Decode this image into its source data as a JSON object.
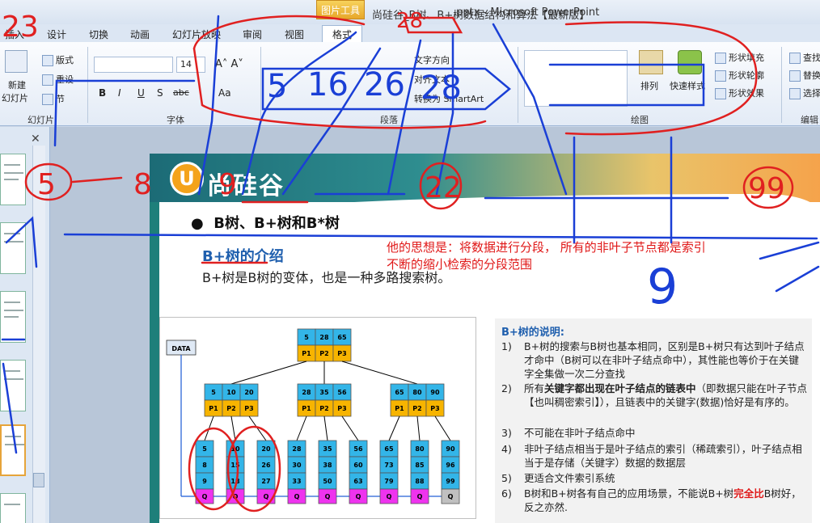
{
  "window": {
    "title_prefix": "尚硅谷_B树、B+树数据结构和算法【最新版】",
    "title": ".pptx - Microsoft PowerPoint",
    "picture_tools": "图片工具"
  },
  "tabs": [
    "插入",
    "设计",
    "切换",
    "动画",
    "幻灯片放映",
    "审阅",
    "视图",
    "格式"
  ],
  "ribbon": {
    "slides_group": {
      "new_slide": "新建",
      "new_slide_sub": "幻灯片",
      "layout": "版式",
      "reset": "重设",
      "section": "节",
      "label": "幻灯片"
    },
    "font_group": {
      "size": "14",
      "label": "字体"
    },
    "paragraph_group": {
      "label": "段落",
      "text_direction": "文字方向",
      "align_text": "对齐文本",
      "smartart": "转换为 SmartArt"
    },
    "drawing_group": {
      "arrange": "排列",
      "quick_styles": "快速样式",
      "shape_fill": "形状填充",
      "shape_outline": "形状轮廓",
      "shape_effects": "形状效果",
      "label": "绘图"
    },
    "editing_group": {
      "find": "查找",
      "replace": "替换",
      "select": "选择",
      "label": "编辑"
    }
  },
  "slide": {
    "logo_text": "尚硅谷",
    "bullet_title": "B树、B+树和B*树",
    "intro_head": "B+树的介绍",
    "intro_text": "B+树是B树的变体，也是一种多路搜索树。",
    "red_note_line1": "他的思想是：将数据进行分段， 所有的非叶子节点都是索引",
    "red_note_line2": "不断的缩小检索的分段范围",
    "explain_head": "B+树的说明:",
    "explain_items": [
      {
        "num": "1)",
        "text": "B+树的搜索与B树也基本相同，区别是B+树只有达到叶子结点才命中（B树可以在非叶子结点命中），其性能也等价于在关键字全集做一次二分查找"
      },
      {
        "num": "2)",
        "pre": "所有",
        "bold": "关键字都出现在叶子结点的链表中",
        "post": "（即数据只能在叶子节点【也叫稠密索引】），且链表中的关键字(数据)恰好是有序的。"
      },
      {
        "num": "3)",
        "text": "不可能在非叶子结点命中"
      },
      {
        "num": "4)",
        "text": "非叶子结点相当于是叶子结点的索引（稀疏索引），叶子结点相当于是存储（关键字）数据的数据层"
      },
      {
        "num": "5)",
        "text": "更适合文件索引系统"
      },
      {
        "num": "6)",
        "pre": "B树和B+树各有自己的应用场景，不能说B+树",
        "red": "完全比",
        "post": "B树好，反之亦然."
      }
    ]
  },
  "diagram": {
    "data_label": "DATA",
    "root": {
      "keys": [
        "5",
        "28",
        "65"
      ],
      "ptrs": [
        "P1",
        "P2",
        "P3"
      ]
    },
    "internal": [
      {
        "keys": [
          "5",
          "10",
          "20"
        ],
        "ptrs": [
          "P1",
          "P2",
          "P3"
        ]
      },
      {
        "keys": [
          "28",
          "35",
          "56"
        ],
        "ptrs": [
          "P1",
          "P2",
          "P3"
        ]
      },
      {
        "keys": [
          "65",
          "80",
          "90"
        ],
        "ptrs": [
          "P1",
          "P2",
          "P3"
        ]
      }
    ],
    "leaves": [
      [
        "5",
        "8",
        "9"
      ],
      [
        "10",
        "15",
        "18"
      ],
      [
        "20",
        "26",
        "27"
      ],
      [
        "28",
        "30",
        "33"
      ],
      [
        "35",
        "38",
        "50"
      ],
      [
        "56",
        "60",
        "63"
      ],
      [
        "65",
        "73",
        "79"
      ],
      [
        "80",
        "85",
        "88"
      ],
      [
        "90",
        "96",
        "99"
      ]
    ],
    "leaf_tail": "Q",
    "colors": {
      "key": "#33b5e8",
      "ptr": "#f7b400",
      "tail": "#ee33ee",
      "tail_last": "#c0c0c0"
    }
  },
  "annotations": {
    "handwritten": [
      "23",
      "5",
      "16",
      "26",
      "28",
      "28",
      "5",
      "8",
      "9",
      "22",
      "99",
      "9"
    ],
    "pen_color": "#1a3fd6",
    "red_pen": "#e02020"
  }
}
